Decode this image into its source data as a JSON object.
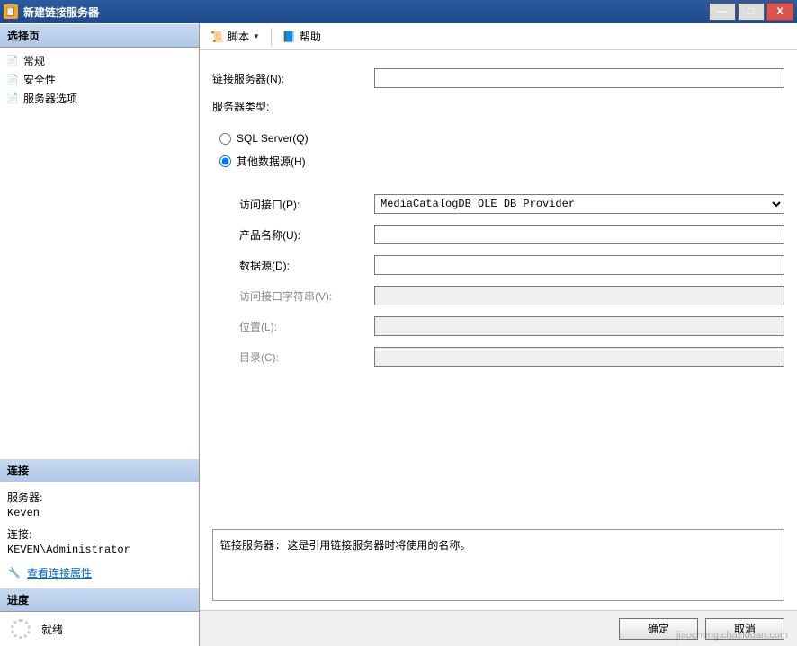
{
  "window": {
    "title": "新建链接服务器"
  },
  "sidebar": {
    "select_page_header": "选择页",
    "nav": [
      {
        "label": "常规",
        "icon": "📄"
      },
      {
        "label": "安全性",
        "icon": "📄"
      },
      {
        "label": "服务器选项",
        "icon": "📄"
      }
    ],
    "connection": {
      "header": "连接",
      "server_label": "服务器:",
      "server_value": "Keven",
      "conn_label": "连接:",
      "conn_value": "KEVEN\\Administrator",
      "view_props": "查看连接属性"
    },
    "progress": {
      "header": "进度",
      "status": "就绪"
    }
  },
  "toolbar": {
    "script_label": "脚本",
    "help_label": "帮助"
  },
  "form": {
    "linked_server_label": "链接服务器(N):",
    "linked_server_value": "",
    "server_type_label": "服务器类型:",
    "radio_sql": "SQL Server(Q)",
    "radio_other": "其他数据源(H)",
    "provider_label": "访问接口(P):",
    "provider_value": "MediaCatalogDB OLE DB Provider",
    "product_label": "产品名称(U):",
    "product_value": "",
    "datasource_label": "数据源(D):",
    "datasource_value": "",
    "provstring_label": "访问接口字符串(V):",
    "location_label": "位置(L):",
    "catalog_label": "目录(C):"
  },
  "hint": "链接服务器: 这是引用链接服务器时将使用的名称。",
  "buttons": {
    "ok": "确定",
    "cancel": "取消"
  },
  "watermark": "jiaocheng.chaziduan.com"
}
